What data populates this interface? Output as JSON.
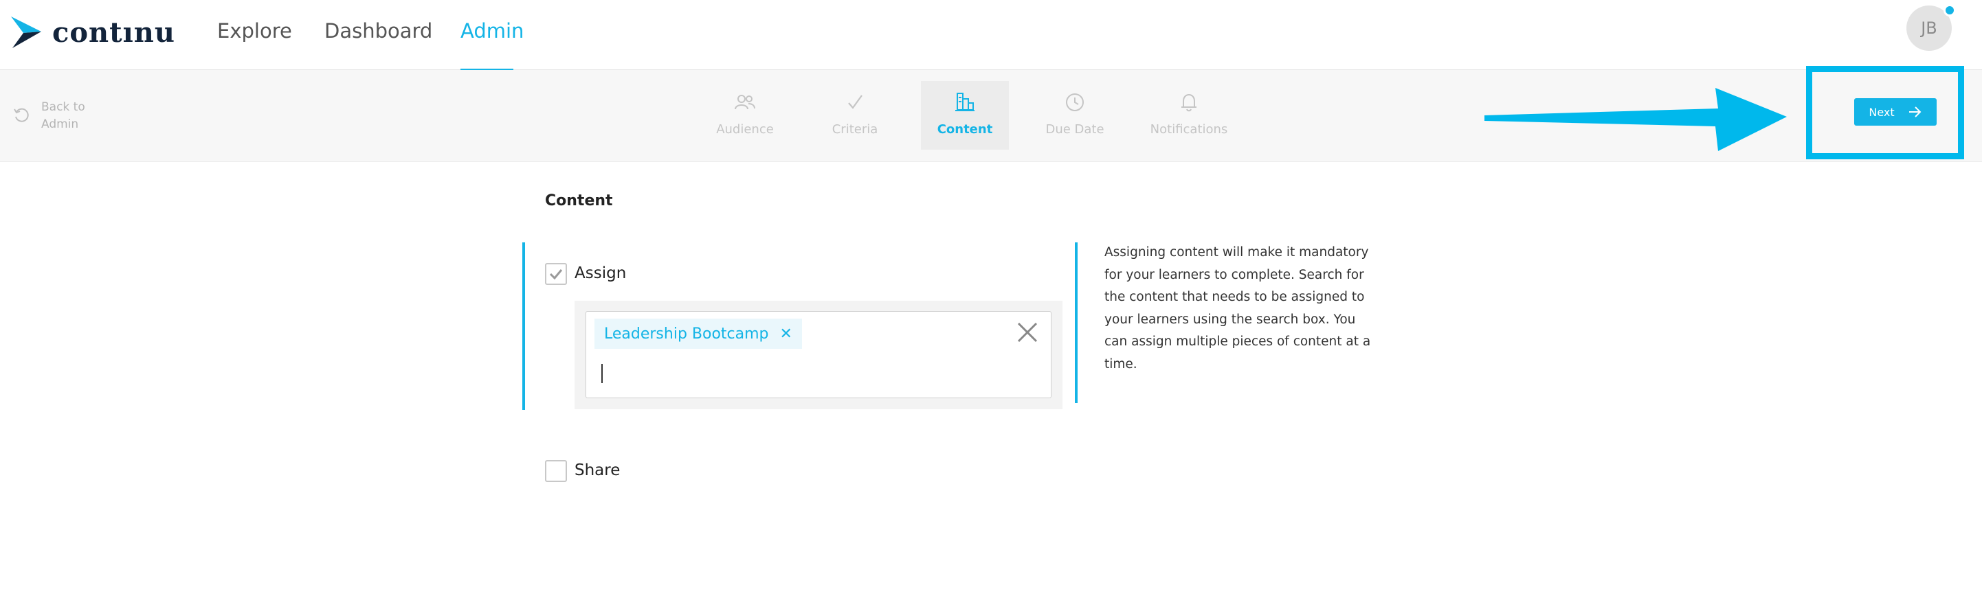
{
  "nav": {
    "brand": "contınu",
    "links": [
      "Explore",
      "Dashboard",
      "Admin"
    ],
    "active_link": "Admin",
    "avatar_initials": "JB"
  },
  "wizard": {
    "back_label_line1": "Back to",
    "back_label_line2": "Admin",
    "steps": [
      {
        "label": "Audience",
        "icon": "people-icon"
      },
      {
        "label": "Criteria",
        "icon": "check-icon"
      },
      {
        "label": "Content",
        "icon": "building-icon"
      },
      {
        "label": "Due Date",
        "icon": "clock-icon"
      },
      {
        "label": "Notifications",
        "icon": "bell-icon"
      }
    ],
    "active_step": "Content",
    "next_label": "Next"
  },
  "content": {
    "title": "Content",
    "assign_label": "Assign",
    "assign_checked": true,
    "selected_items": [
      "Leadership Bootcamp"
    ],
    "search_value": "",
    "share_label": "Share",
    "share_checked": false,
    "help_text": "Assigning content will make it mandatory for your learners to complete. Search for the content that needs to be assigned to your learners using the search box. You can assign multiple pieces of content at a time."
  },
  "colors": {
    "accent": "#14b4e6",
    "annotation": "#00b8ec",
    "brand_dark": "#13243b"
  }
}
